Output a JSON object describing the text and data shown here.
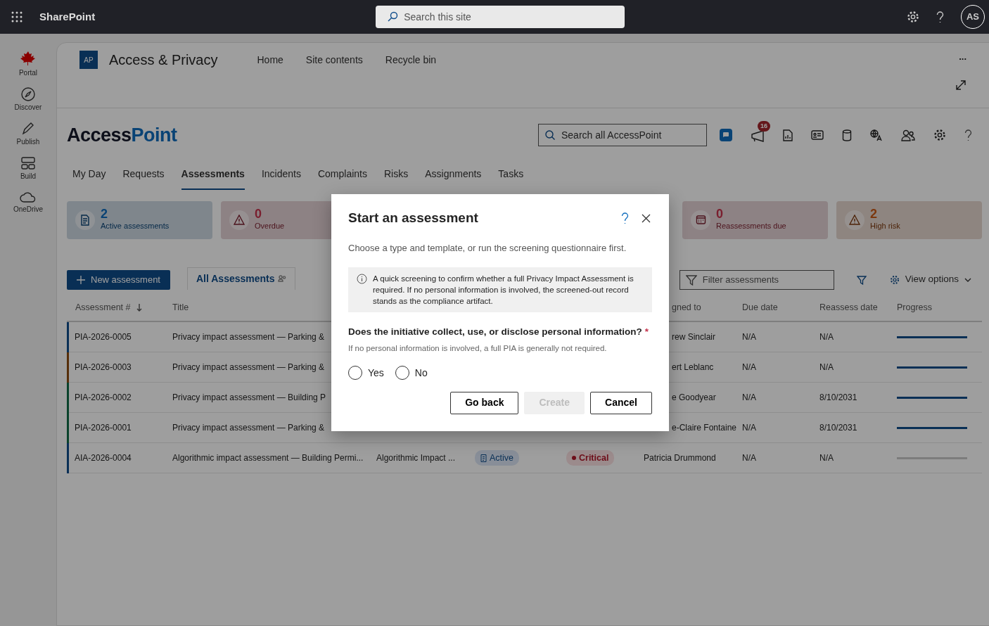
{
  "topbar": {
    "app_name": "SharePoint",
    "search_placeholder": "Search this site",
    "avatar": "AS"
  },
  "rail": [
    {
      "label": "Portal",
      "kind": "leaf"
    },
    {
      "label": "Discover",
      "kind": "compass"
    },
    {
      "label": "Publish",
      "kind": "pen"
    },
    {
      "label": "Build",
      "kind": "layout"
    },
    {
      "label": "OneDrive",
      "kind": "cloud"
    }
  ],
  "site": {
    "logo": "AP",
    "title": "Access & Privacy",
    "links": [
      "Home",
      "Site contents",
      "Recycle bin"
    ],
    "more": "..."
  },
  "app": {
    "brand_start": "Access",
    "brand_end": "Point",
    "search_placeholder": "Search all AccessPoint",
    "notification_count": "16"
  },
  "tabs": [
    {
      "label": "My Day",
      "selected": false
    },
    {
      "label": "Requests",
      "selected": false
    },
    {
      "label": "Assessments",
      "selected": true
    },
    {
      "label": "Incidents",
      "selected": false
    },
    {
      "label": "Complaints",
      "selected": false
    },
    {
      "label": "Risks",
      "selected": false
    },
    {
      "label": "Assignments",
      "selected": false
    },
    {
      "label": "Tasks",
      "selected": false
    }
  ],
  "kpis_left": [
    {
      "value": "2",
      "label": "Active assessments",
      "kind": "doc",
      "color": "#094375"
    },
    {
      "value": "0",
      "label": "Overdue",
      "kind": "warning",
      "color": "#7a1e2e"
    }
  ],
  "kpis_right": [
    {
      "value": "0",
      "label": "Reassessments due",
      "kind": "calendar",
      "color": "#7a1e2e"
    },
    {
      "value": "2",
      "label": "High risk",
      "kind": "warning",
      "color": "#7c380e"
    }
  ],
  "toolbar": {
    "new_button": "New assessment",
    "view_tab": "All Assessments",
    "filter_placeholder": "Filter assessments",
    "view_options": "View options"
  },
  "columns": {
    "id": "Assessment #",
    "title": "Title",
    "assigned_to": "gned to",
    "due_date": "Due date",
    "reassess_date": "Reassess date",
    "progress": "Progress",
    "partly_hidden": true
  },
  "rows": [
    {
      "id": "PIA-2026-0005",
      "title": "Privacy impact assessment — Parking &",
      "assigned_to": "rew Sinclair",
      "due_date": "N/A",
      "reassess_date": "N/A",
      "level": 1,
      "color": "#092f56",
      "partly_hidden": true
    },
    {
      "id": "PIA-2026-0003",
      "title": "Privacy impact assessment — Parking &",
      "assigned_to": "ert Leblanc",
      "due_date": "N/A",
      "reassess_date": "N/A",
      "level": 1,
      "color": "#562e09",
      "partly_hidden": true
    },
    {
      "id": "PIA-2026-0002",
      "title": "Privacy impact assessment — Building P",
      "assigned_to": "e Goodyear",
      "due_date": "N/A",
      "reassess_date": "8/10/2031",
      "level": 1,
      "color": "#09422b",
      "partly_hidden": true
    },
    {
      "id": "PIA-2026-0001",
      "title": "Privacy impact assessment — Parking &",
      "assigned_to": "e-Claire Fontaine",
      "due_date": "N/A",
      "reassess_date": "8/10/2031",
      "level": 1,
      "color": "#09422b",
      "partly_hidden": true
    },
    {
      "id": "AIA-2026-0004",
      "title": "Algorithmic impact assessment — Building Permi...",
      "type": "Algorithmic Impact ...",
      "status": "Active",
      "risk": "Critical",
      "assigned_to": "Patricia Drummond",
      "due_date": "N/A",
      "reassess_date": "N/A",
      "level": 0,
      "color": "#092f56",
      "partly_hidden": false
    }
  ],
  "dialog": {
    "title": "Start an assessment",
    "subtitle": "Choose a type and template, or run the screening questionnaire first.",
    "info": "A quick screening to confirm whether a full Privacy Impact Assessment is required. If no personal information is involved, the screened-out record stands as the compliance artifact.",
    "question": "Does the initiative collect, use, or disclose personal information?",
    "required_mark": "*",
    "hint": "If no personal information is involved, a full PIA is generally not required.",
    "options": [
      {
        "label": "Yes",
        "selected": false
      },
      {
        "label": "No",
        "selected": false
      }
    ],
    "buttons": [
      {
        "label": "Go back",
        "disabled": false
      },
      {
        "label": "Create",
        "disabled": true
      },
      {
        "label": "Cancel",
        "disabled": false
      }
    ]
  }
}
